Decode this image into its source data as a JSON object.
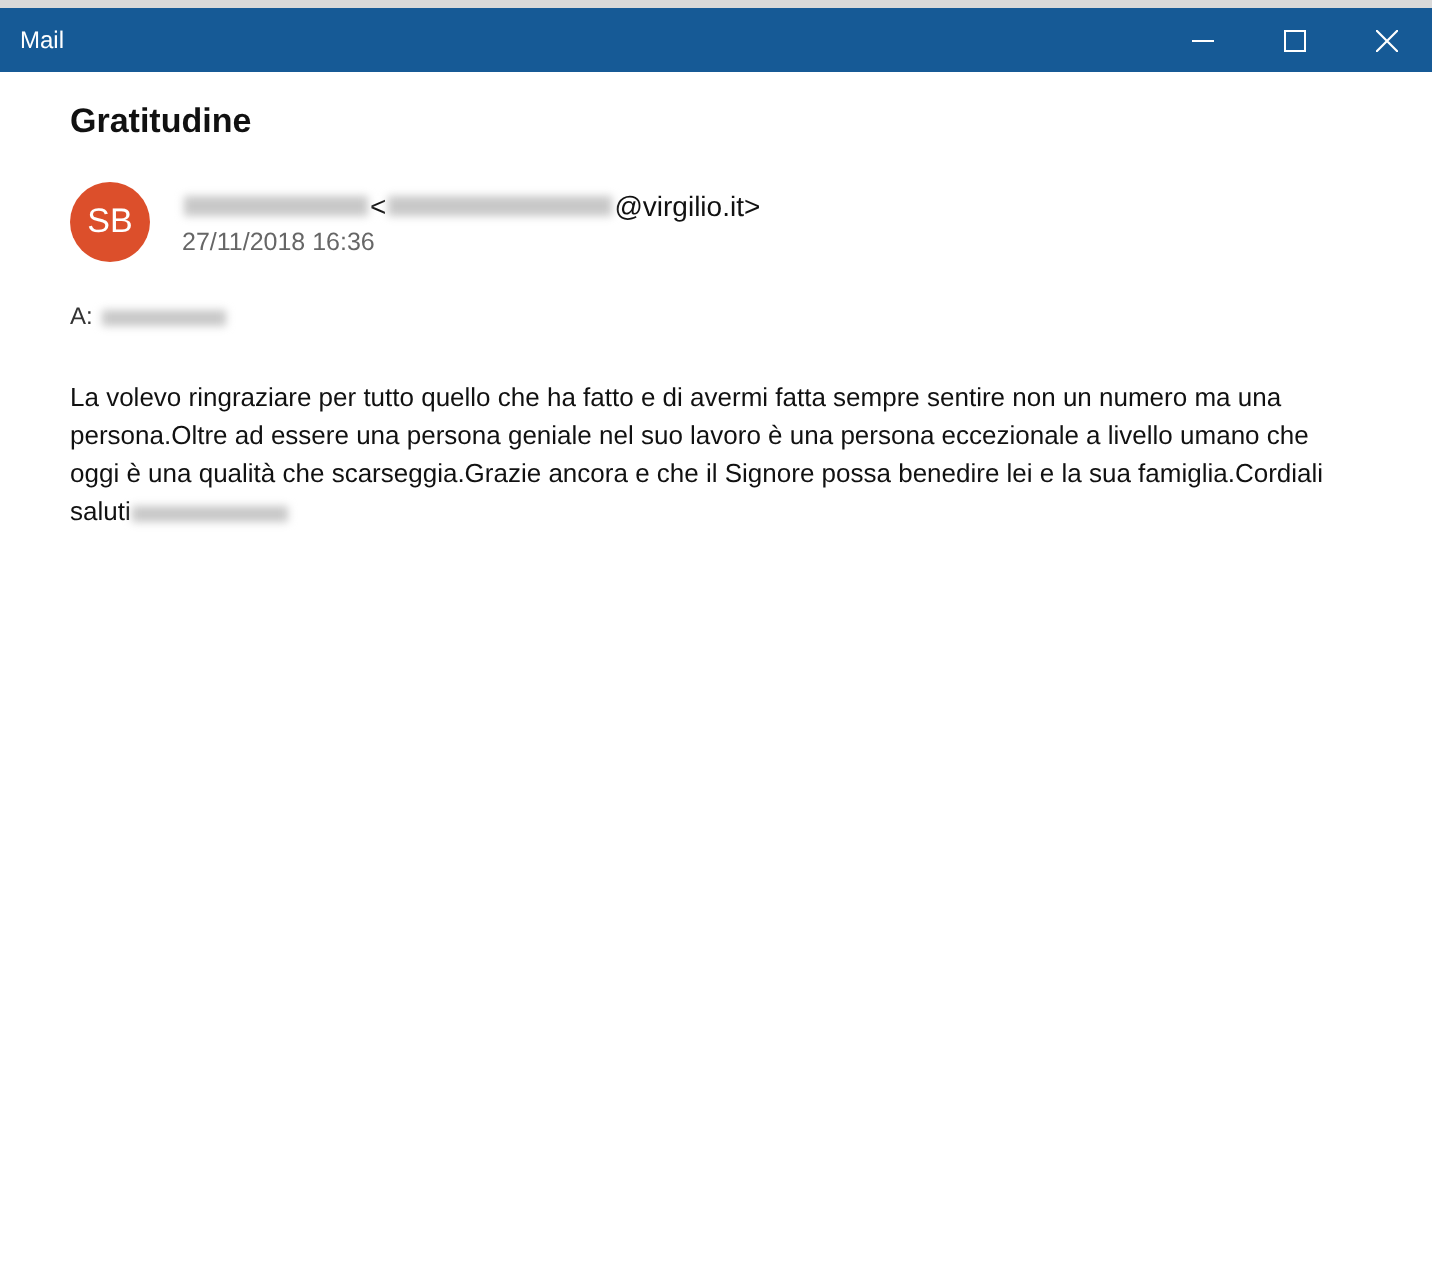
{
  "window": {
    "title": "Mail"
  },
  "message": {
    "subject": "Gratitudine",
    "avatar_initials": "SB",
    "sender_open": "<",
    "sender_domain": "@virgilio.it>",
    "date": "27/11/2018 16:36",
    "to_label": "A:",
    "body": "La volevo ringraziare per tutto quello che ha fatto e di avermi fatta sempre sentire non un numero ma una persona.Oltre ad essere una persona geniale nel suo lavoro è una persona eccezionale a livello umano che oggi è una qualità che scarseggia.Grazie ancora e che il Signore possa benedire lei e la sua famiglia.Cordiali saluti"
  }
}
